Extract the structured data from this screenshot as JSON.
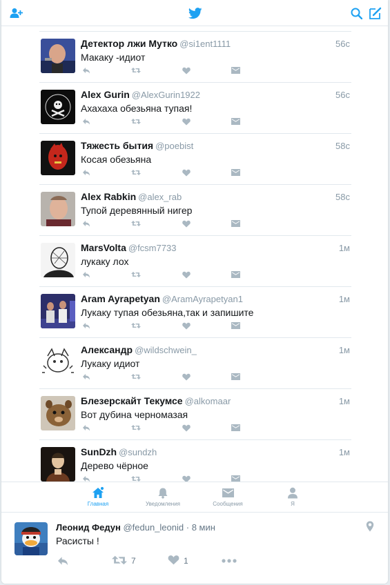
{
  "header": {
    "left_icon": "add-user-icon",
    "center_icon": "twitter-bird-icon",
    "right_icons": [
      "search-icon",
      "compose-icon"
    ],
    "accent": "#1da1f2"
  },
  "tweets": [
    {
      "name": "Детектор лжи Мутко",
      "handle": "@si1ent1111",
      "time": "56с",
      "text": "Макаку -идиот"
    },
    {
      "name": "Alex Gurin",
      "handle": "@AlexGurin1922",
      "time": "56с",
      "text": "Ахахаха обезьяна тупая!"
    },
    {
      "name": "Тяжесть бытия",
      "handle": "@poebist",
      "time": "58с",
      "text": "Косая обезьяна"
    },
    {
      "name": "Alex Rabkin",
      "handle": "@alex_rab",
      "time": "58с",
      "text": "Тупой деревянный нигер"
    },
    {
      "name": "MarsVolta",
      "handle": "@fcsm7733",
      "time": "1м",
      "text": "лукаку лох"
    },
    {
      "name": "Aram Ayrapetyan",
      "handle": "@AramAyrapetyan1",
      "time": "1м",
      "text": "Лукаку тупая обезьяна,так и запишите"
    },
    {
      "name": "Александр",
      "handle": "@wildschwein_",
      "time": "1м",
      "text": "Лукаку идиот"
    },
    {
      "name": "Блезерскайт Текумсе",
      "handle": "@alkomaar",
      "time": "1м",
      "text": "Вот дубина черномазая"
    },
    {
      "name": "SunDzh",
      "handle": "@sundzh",
      "time": "1м",
      "text": "Дерево чёрное"
    }
  ],
  "tabs": [
    {
      "label": "Главная",
      "icon": "home-icon",
      "active": true
    },
    {
      "label": "Уведомления",
      "icon": "bell-icon",
      "active": false
    },
    {
      "label": "Сообщения",
      "icon": "envelope-icon",
      "active": false
    },
    {
      "label": "Я",
      "icon": "person-icon",
      "active": false
    }
  ],
  "footer_tweet": {
    "name": "Леонид Федун",
    "handle": "@fedun_leonid",
    "dot": "·",
    "time": "8 мин",
    "text": "Расисты !",
    "retweets": "7",
    "likes": "1"
  }
}
